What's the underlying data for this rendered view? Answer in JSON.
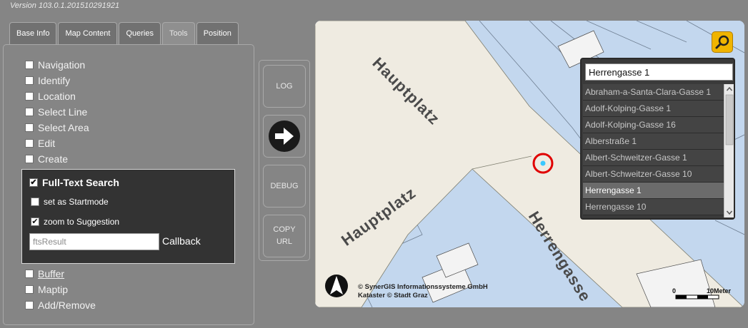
{
  "version_text": "Version 103.0.1.201510291921",
  "tabs": [
    {
      "label": "Base Info"
    },
    {
      "label": "Map Content"
    },
    {
      "label": "Queries"
    },
    {
      "label": "Tools"
    },
    {
      "label": "Position"
    }
  ],
  "tools": {
    "navigation": "Navigation",
    "identify": "Identify",
    "location": "Location",
    "select_line": "Select Line",
    "select_area": "Select Area",
    "edit": "Edit",
    "create": "Create",
    "buffer": "Buffer",
    "maptip": "Maptip",
    "add_remove": "Add/Remove"
  },
  "fts": {
    "title": "Full-Text Search",
    "startmode_label": "set as Startmode",
    "zoom_label": "zoom to Suggestion",
    "callback_value": "ftsResult",
    "callback_label": "Callback"
  },
  "side_buttons": {
    "log": "LOG",
    "debug": "DEBUG",
    "copy_url": "COPY URL"
  },
  "map": {
    "streets": [
      "Hauptplatz",
      "Hauptplatz",
      "Herrengasse"
    ],
    "copyright_line1": "© SynerGIS Informationssysteme GmbH",
    "copyright_line2": "Kataster © Stadt Graz",
    "scale_start": "0",
    "scale_end": "10Meter"
  },
  "search": {
    "value": "Herrengasse 1",
    "suggestions": [
      "Abraham-a-Santa-Clara-Gasse 1",
      "Adolf-Kolping-Gasse 1",
      "Adolf-Kolping-Gasse 16",
      "Alberstraße 1",
      "Albert-Schweitzer-Gasse 1",
      "Albert-Schweitzer-Gasse 10",
      "Herrengasse 1",
      "Herrengasse 10"
    ],
    "selected_index": 6
  },
  "colors": {
    "background": "#858585",
    "accent": "#f0b400",
    "marker": "#e00000",
    "water_parcels": "#c3d7ee",
    "road": "#efebe1"
  }
}
